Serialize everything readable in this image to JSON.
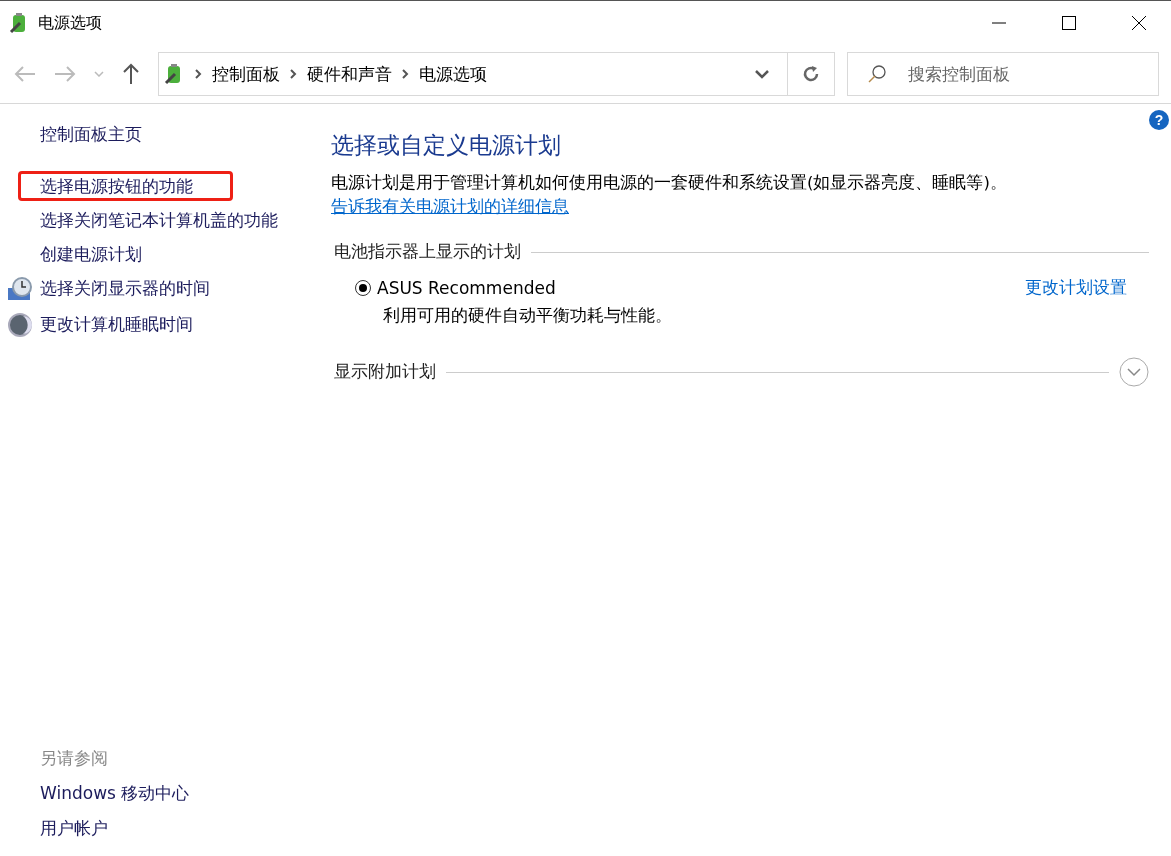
{
  "window": {
    "title": "电源选项"
  },
  "address_bar": {
    "breadcrumbs": [
      "控制面板",
      "硬件和声音",
      "电源选项"
    ]
  },
  "search": {
    "placeholder": "搜索控制面板"
  },
  "sidebar": {
    "items": [
      {
        "label": "控制面板主页",
        "kind": "plain",
        "highlighted": false
      },
      {
        "label": "选择电源按钮的功能",
        "kind": "plain",
        "highlighted": true
      },
      {
        "label": "选择关闭笔记本计算机盖的功能",
        "kind": "plain",
        "highlighted": false
      },
      {
        "label": "创建电源计划",
        "kind": "plain",
        "highlighted": false
      },
      {
        "label": "选择关闭显示器的时间",
        "kind": "clock",
        "highlighted": false
      },
      {
        "label": "更改计算机睡眠时间",
        "kind": "sleep",
        "highlighted": false
      }
    ],
    "see_also": {
      "heading": "另请参阅",
      "links": [
        "Windows 移动中心",
        "用户帐户"
      ]
    }
  },
  "main": {
    "help": "?",
    "title": "选择或自定义电源计划",
    "description": "电源计划是用于管理计算机如何使用电源的一套硬件和系统设置(如显示器亮度、睡眠等)。",
    "description_link": "告诉我有关电源计划的详细信息",
    "battery_section": {
      "heading": "电池指示器上显示的计划",
      "plans": [
        {
          "name": "ASUS Recommended",
          "description": "利用可用的硬件自动平衡功耗与性能。",
          "selected": true,
          "settings_link": "更改计划设置"
        }
      ]
    },
    "additional_section": {
      "heading": "显示附加计划",
      "expanded": false
    }
  }
}
